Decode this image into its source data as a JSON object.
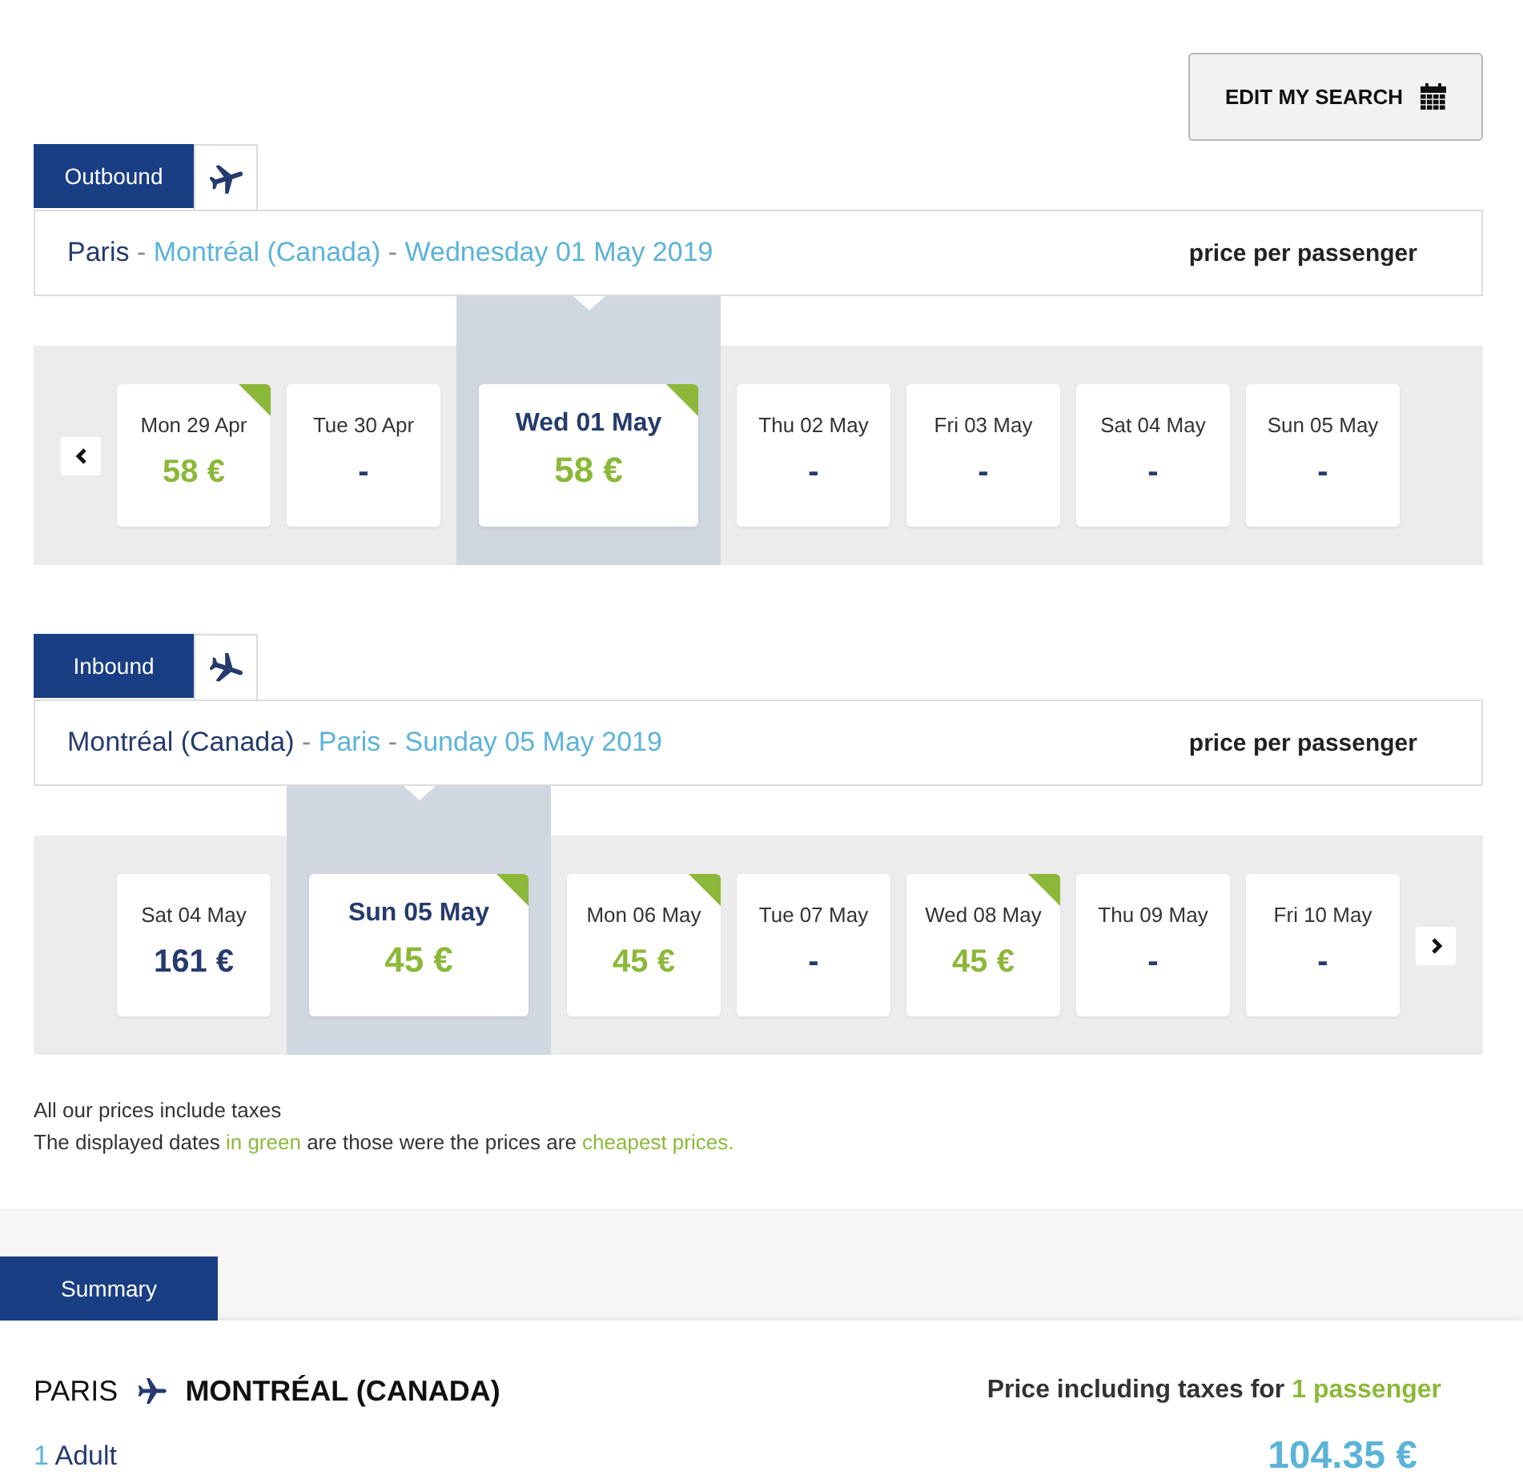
{
  "edit_search": {
    "label": "EDIT MY SEARCH"
  },
  "legs": [
    {
      "kind": "outbound",
      "tab": "Outbound",
      "route": {
        "origin": "Paris",
        "destination": "Montréal (Canada)",
        "date": "Wednesday 01 May 2019",
        "separator": "-"
      },
      "price_label": "price per passenger",
      "arrows": {
        "previous": true,
        "next": false
      },
      "days": [
        {
          "date": "Mon 29 Apr",
          "price": "58 €",
          "cheapest": true,
          "selected": false
        },
        {
          "date": "Tue 30 Apr",
          "price": "-",
          "cheapest": false,
          "selected": false
        },
        {
          "date": "Wed 01 May",
          "price": "58 €",
          "cheapest": true,
          "selected": true
        },
        {
          "date": "Thu 02 May",
          "price": "-",
          "cheapest": false,
          "selected": false
        },
        {
          "date": "Fri 03 May",
          "price": "-",
          "cheapest": false,
          "selected": false
        },
        {
          "date": "Sat 04 May",
          "price": "-",
          "cheapest": false,
          "selected": false
        },
        {
          "date": "Sun 05 May",
          "price": "-",
          "cheapest": false,
          "selected": false
        }
      ]
    },
    {
      "kind": "inbound",
      "tab": "Inbound",
      "route": {
        "origin": "Montréal (Canada)",
        "destination": "Paris",
        "date": "Sunday 05 May 2019",
        "separator": "-"
      },
      "price_label": "price per passenger",
      "arrows": {
        "previous": false,
        "next": true
      },
      "days": [
        {
          "date": "Sat 04 May",
          "price": "161 €",
          "cheapest": false,
          "selected": false
        },
        {
          "date": "Sun 05 May",
          "price": "45 €",
          "cheapest": true,
          "selected": true
        },
        {
          "date": "Mon 06 May",
          "price": "45 €",
          "cheapest": true,
          "selected": false
        },
        {
          "date": "Tue 07 May",
          "price": "-",
          "cheapest": false,
          "selected": false
        },
        {
          "date": "Wed 08 May",
          "price": "45 €",
          "cheapest": true,
          "selected": false
        },
        {
          "date": "Thu 09 May",
          "price": "-",
          "cheapest": false,
          "selected": false
        },
        {
          "date": "Fri 10 May",
          "price": "-",
          "cheapest": false,
          "selected": false
        }
      ]
    }
  ],
  "notes": [
    {
      "segments": [
        {
          "text": "All our prices include taxes",
          "highlight": false
        }
      ]
    },
    {
      "segments": [
        {
          "text": "The displayed dates ",
          "highlight": false
        },
        {
          "text": "in green",
          "highlight": true
        },
        {
          "text": " are those were the prices are ",
          "highlight": false
        },
        {
          "text": "cheapest prices.",
          "highlight": true
        }
      ]
    }
  ],
  "summary": {
    "tab": "Summary",
    "origin": "PARIS",
    "destination": "MONTRÉAL (CANADA)",
    "passengers": {
      "count": "1",
      "label": "Adult"
    },
    "price_caption": [
      {
        "text": "Price including taxes for ",
        "highlight": false
      },
      {
        "text": "1 passenger",
        "highlight": true
      }
    ],
    "total": "104.35 €"
  }
}
